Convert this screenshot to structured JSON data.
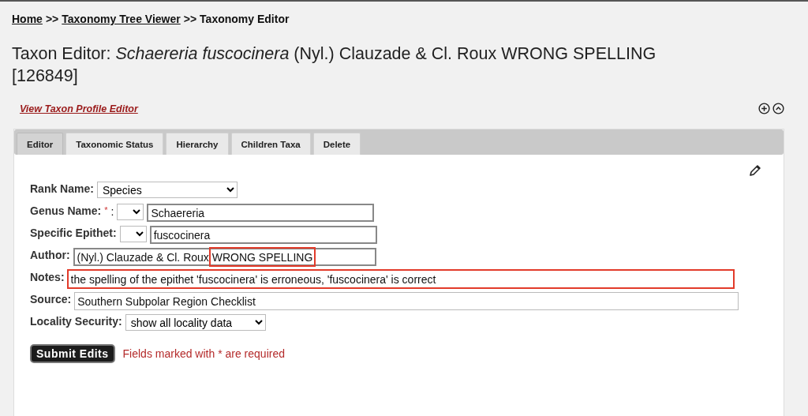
{
  "breadcrumb": [
    {
      "text": "Home",
      "link": true
    },
    {
      "text": ">>",
      "link": false
    },
    {
      "text": "Taxonomy Tree Viewer",
      "link": true
    },
    {
      "text": ">>",
      "link": false
    },
    {
      "text": "Taxonomy Editor",
      "link": false
    }
  ],
  "title": {
    "prefix": "Taxon Editor:",
    "name": "Schaereria fuscocinera",
    "rest": "(Nyl.) Clauzade & Cl. Roux WRONG SPELLING [126849]"
  },
  "profile_link": "View Taxon Profile Editor",
  "tabs": [
    {
      "label": "Editor",
      "selected": true
    },
    {
      "label": "Taxonomic Status",
      "selected": false
    },
    {
      "label": "Hierarchy",
      "selected": false
    },
    {
      "label": "Children Taxa",
      "selected": false
    },
    {
      "label": "Delete",
      "selected": false
    }
  ],
  "form": [
    {
      "kind": "select",
      "label": "Rank Name:",
      "value": "Species",
      "required": false
    },
    {
      "kind": "unit",
      "label": "Genus Name:",
      "required": true,
      "value": "Schaereria"
    },
    {
      "kind": "unit",
      "label": "Specific Epithet:",
      "required": false,
      "value": "fuscocinera"
    },
    {
      "kind": "parts",
      "label": "Author:",
      "required": false,
      "parts": [
        {
          "text": "(Nyl.) Clauzade & Cl. Roux ",
          "highlighted": false
        },
        {
          "text": "WRONG SPELLING",
          "highlighted": true
        }
      ]
    },
    {
      "kind": "wide",
      "label": "Notes:",
      "required": false,
      "value": "the spelling of the epithet 'fuscocinera' is erroneous, 'fuscocinera' is correct",
      "highlighted": true
    },
    {
      "kind": "wide",
      "label": "Source:",
      "required": false,
      "value": "Southern Subpolar Region Checklist",
      "highlighted": false
    },
    {
      "kind": "select",
      "label": "Locality Security:",
      "value": "show all locality data",
      "required": false
    }
  ],
  "submit": "Submit Edits",
  "required_note": "Fields marked with * are required",
  "required_mark": "*",
  "colon": ":"
}
